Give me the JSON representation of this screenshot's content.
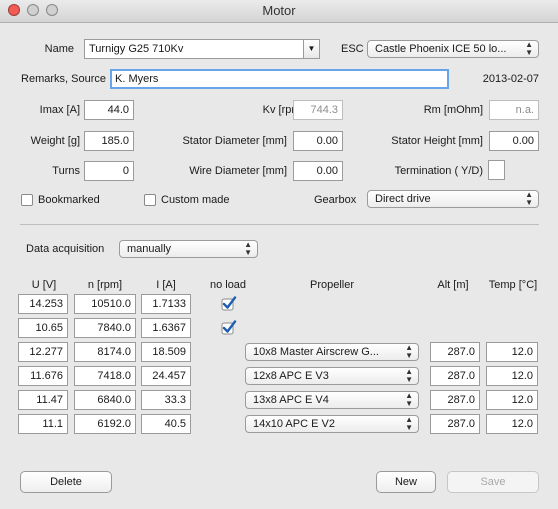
{
  "window": {
    "title": "Motor"
  },
  "motor": {
    "name_label": "Name",
    "name_value": "Turnigy G25 710Kv",
    "esc_label": "ESC",
    "esc_value": "Castle Phoenix ICE 50 lo...",
    "remarks_label": "Remarks, Source",
    "remarks_value": "K. Myers",
    "date": "2013-02-07",
    "imax_label": "Imax [A]",
    "imax_value": "44.0",
    "kv_label": "Kv [rpm/V]",
    "kv_value": "744.3",
    "rm_label": "Rm [mOhm]",
    "rm_placeholder": "n.a.",
    "weight_label": "Weight [g]",
    "weight_value": "185.0",
    "stator_diameter_label": "Stator Diameter [mm]",
    "stator_diameter_value": "0.00",
    "stator_height_label": "Stator Height [mm]",
    "stator_height_value": "0.00",
    "turns_label": "Turns",
    "turns_value": "0",
    "wire_diameter_label": "Wire Diameter [mm]",
    "wire_diameter_value": "0.00",
    "termination_label": "Termination ( Y/D)",
    "termination_value": "",
    "bookmarked_label": "Bookmarked",
    "bookmarked_checked": false,
    "custom_made_label": "Custom made",
    "custom_made_checked": false,
    "gearbox_label": "Gearbox",
    "gearbox_value": "Direct drive"
  },
  "acquisition": {
    "label": "Data acquisition",
    "value": "manually"
  },
  "table": {
    "headers": {
      "u": "U [V]",
      "n": "n [rpm]",
      "i": "I [A]",
      "noload": "no load",
      "propeller": "Propeller",
      "alt": "Alt [m]",
      "temp": "Temp [°C]"
    },
    "rows": [
      {
        "u": "14.253",
        "n": "10510.0",
        "i": "1.7133",
        "noload": true,
        "propeller": "",
        "alt": "",
        "temp": ""
      },
      {
        "u": "10.65",
        "n": "7840.0",
        "i": "1.6367",
        "noload": true,
        "propeller": "",
        "alt": "",
        "temp": ""
      },
      {
        "u": "12.277",
        "n": "8174.0",
        "i": "18.509",
        "noload": false,
        "propeller": "10x8 Master Airscrew G...",
        "alt": "287.0",
        "temp": "12.0"
      },
      {
        "u": "11.676",
        "n": "7418.0",
        "i": "24.457",
        "noload": false,
        "propeller": "12x8 APC E V3",
        "alt": "287.0",
        "temp": "12.0"
      },
      {
        "u": "11.47",
        "n": "6840.0",
        "i": "33.3",
        "noload": false,
        "propeller": "13x8 APC E V4",
        "alt": "287.0",
        "temp": "12.0"
      },
      {
        "u": "11.1",
        "n": "6192.0",
        "i": "40.5",
        "noload": false,
        "propeller": "14x10 APC E V2",
        "alt": "287.0",
        "temp": "12.0"
      }
    ]
  },
  "buttons": {
    "delete": "Delete",
    "new": "New",
    "save": "Save"
  },
  "icons": {
    "popup_arrows": "up-down-arrows-icon",
    "combo_arrow": "chevron-down-icon",
    "check": "checkmark-icon"
  },
  "colors": {
    "check": "#1f5fb0",
    "focus": "#6aa4e8",
    "window_bg": "#e8e8e8"
  }
}
